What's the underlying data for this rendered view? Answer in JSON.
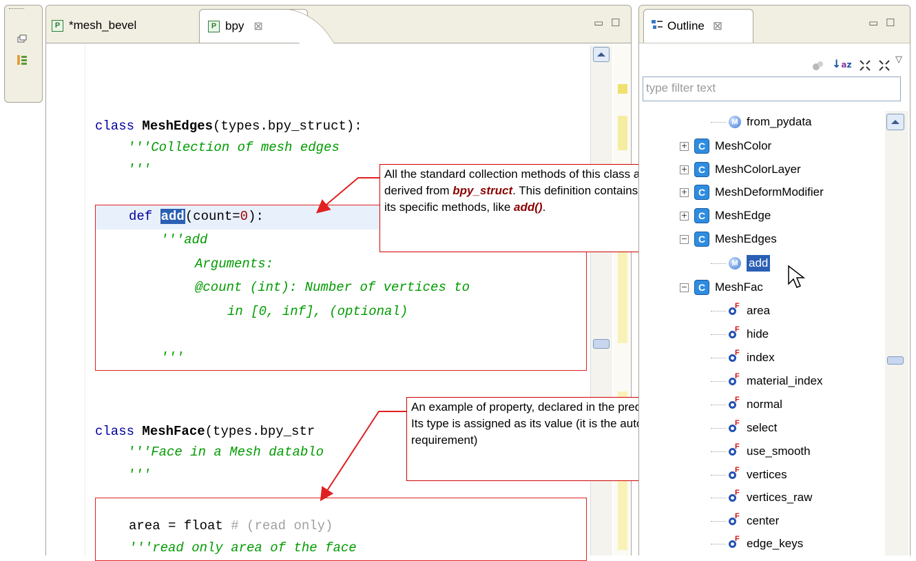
{
  "editor": {
    "tabs": [
      {
        "label": "*mesh_bevel",
        "icon": "python-file-icon"
      },
      {
        "label": "bpy",
        "icon": "python-file-icon",
        "close": "⊠"
      }
    ],
    "code": {
      "l1_kw": "class",
      "l1_name": "MeshEdges",
      "l1_rest": "(types.bpy_struct):",
      "l2": "'''Collection of mesh edges",
      "l3": "'''",
      "l4_kw": "def",
      "l4_name": "add",
      "l4_arg": "(count=",
      "l4_num": "0",
      "l4_end": "):",
      "l5": "'''add",
      "l6": "Arguments:",
      "l7": "@count (int): Number of vertices to",
      "l8": "in [0, inf], (optional)",
      "l9": "'''",
      "l10_kw": "class",
      "l10_name": "MeshFace",
      "l10_rest": "(types.bpy_str",
      "l11": "'''Face in a Mesh datablo",
      "l12": "'''",
      "l13_a": "area = float",
      "l13_c": "# (read only)",
      "l14": "'''read only area of the face"
    }
  },
  "callouts": {
    "c1_t1": "All the standard collection methods of this class are derived from ",
    "c1_b1": "bpy_struct",
    "c1_t2": ". This definition contains only its specific methods, like ",
    "c1_b2": "add()",
    "c1_t3": ".",
    "c2_t1": "An example of property, declared in the predefinition file.",
    "c2_t2": "Its type is assigned as its value (it is the autocompletion requirement)"
  },
  "outline": {
    "title": "Outline",
    "close": "⊠",
    "filter_placeholder": "type filter text",
    "top_item": "from_pydata",
    "classes": [
      "MeshColor",
      "MeshColorLayer",
      "MeshDeformModifier",
      "MeshEdge",
      "MeshEdges"
    ],
    "method_add": "add",
    "face_class": "MeshFac",
    "fields": [
      "area",
      "hide",
      "index",
      "material_index",
      "normal",
      "select",
      "use_smooth",
      "vertices",
      "vertices_raw",
      "center",
      "edge_keys"
    ]
  },
  "colors": {
    "selection": "#2b5fb4",
    "callout_border": "#d00000",
    "docstring": "#009b00",
    "keyword": "#0000a0"
  }
}
